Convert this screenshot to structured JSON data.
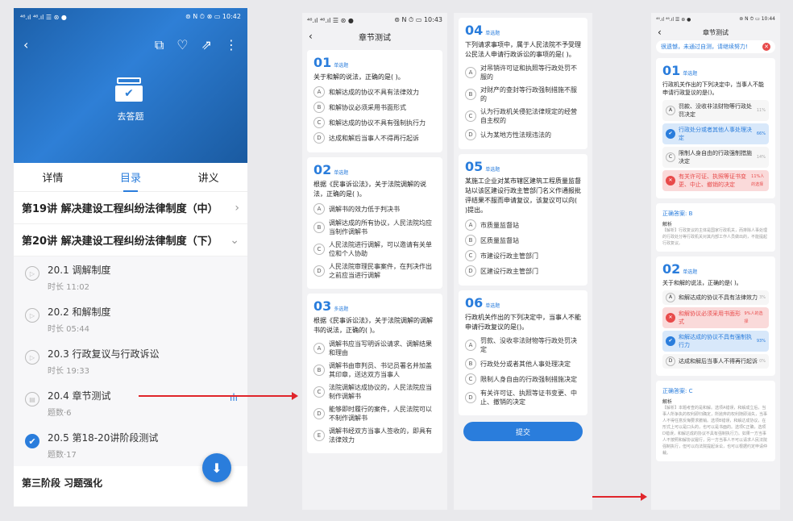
{
  "panel1": {
    "status_left": "⁴⁶.ıl ⁴⁶.ıl ☰ ⊛ ●",
    "status_right": "⊚ N ⏱ ⊗ ▭ 10:42",
    "hero_label": "去答题",
    "tabs": [
      "详情",
      "目录",
      "讲义"
    ],
    "sections": [
      {
        "title": "第19讲  解决建设工程纠纷法律制度（中）",
        "chevron": "›"
      },
      {
        "title": "第20讲  解决建设工程纠纷法律制度（下）",
        "chevron": "⌄"
      }
    ],
    "items": [
      {
        "title": "20.1  调解制度",
        "sub": "时长 11:02"
      },
      {
        "title": "20.2  和解制度",
        "sub": "时长 05:44"
      },
      {
        "title": "20.3  行政复议与行政诉讼",
        "sub": "时长 19:33"
      },
      {
        "title": "20.4  章节测试",
        "sub": "题数·6"
      },
      {
        "title": "20.5  第18-20讲阶段测试",
        "sub": "题数·17"
      }
    ],
    "stage_title": "第三阶段  习题强化"
  },
  "panel2": {
    "status_right": "⊚ N ⏱ ▭ 10:43",
    "title": "章节测试",
    "questions": [
      {
        "num": "01",
        "type": "单选题",
        "text": "关于和解的说法，正确的是(    )。",
        "options": [
          [
            "A",
            "和解达成的协议不具有法律效力"
          ],
          [
            "B",
            "和解协议必须采用书面形式"
          ],
          [
            "C",
            "和解达成的协议不具有强制执行力"
          ],
          [
            "D",
            "达成和解后当事人不得再行起诉"
          ]
        ]
      },
      {
        "num": "02",
        "type": "单选题",
        "text": "根据《民事诉讼法》，关于法院调解的说法，正确的是(    )。",
        "options": [
          [
            "A",
            "调解书的效力低于判决书"
          ],
          [
            "B",
            "调解达成的所有协议，人民法院均应当制作调解书"
          ],
          [
            "C",
            "人民法院进行调解，可以邀请有关单位和个人协助"
          ],
          [
            "D",
            "人民法院审理民事案件，在判决作出之前应当进行调解"
          ]
        ]
      },
      {
        "num": "03",
        "type": "多选题",
        "text": "根据《民事诉讼法》，关于法院调解的调解书的说法，正确的(    )。",
        "options": [
          [
            "A",
            "调解书应当写明诉讼请求、调解结果和理由"
          ],
          [
            "B",
            "调解书由审判员、书记员署名并加盖其印章，送达双方当事人"
          ],
          [
            "C",
            "法院调解达成协议的，人民法院应当制作调解书"
          ],
          [
            "D",
            "能够即时履行的案件，人民法院可以不制作调解书"
          ],
          [
            "E",
            "调解书经双方当事人签收的，即具有法律效力"
          ]
        ]
      }
    ]
  },
  "panel3": {
    "questions": [
      {
        "num": "04",
        "type": "单选题",
        "text": "下列请求事项中，属于人民法院不予受理公民法人申请行政诉讼的事项的是(    )。",
        "options": [
          [
            "A",
            "对吊销许可证和执照等行政处罚不服的"
          ],
          [
            "B",
            "对财产的查封等行政强制措施不服的"
          ],
          [
            "C",
            "认为行政机关侵犯法律规定的经营自主权的"
          ],
          [
            "D",
            "认为某地方性法规违法的"
          ]
        ]
      },
      {
        "num": "05",
        "type": "单选题",
        "text": "某施工企业对某市辖区建筑工程质量监督站以该区建设行政主管部门名义作通报批评结果不服而申请复议，该复议可以向(    )提出。",
        "options": [
          [
            "A",
            "市质量监督站"
          ],
          [
            "B",
            "区质量监督站"
          ],
          [
            "C",
            "市建设行政主管部门"
          ],
          [
            "D",
            "区建设行政主管部门"
          ]
        ]
      },
      {
        "num": "06",
        "type": "单选题",
        "text": "行政机关作出的下列决定中，当事人不能申请行政复议的是()。",
        "options": [
          [
            "A",
            "罚款、没收非法财物等行政处罚决定"
          ],
          [
            "B",
            "行政处分或者其他人事处理决定"
          ],
          [
            "C",
            "限制人身自由的行政强制措施决定"
          ],
          [
            "D",
            "有关许可证、执照等证书变更、中止、撤销的决定"
          ]
        ]
      }
    ],
    "submit_label": "提交"
  },
  "panel4": {
    "status_right": "⊚ N ⏱ ▭ 10:44",
    "title": "章节测试",
    "fail_msg": "很遗憾，未通过自测，请继续努力!",
    "q1": {
      "num": "01",
      "type": "单选题",
      "text": "行政机关作出的下列决定中，当事人不能申请行政复议的是()。",
      "options": [
        [
          "A",
          "罚款、没收非法财物等行政处罚决定",
          "11%"
        ],
        [
          "B",
          "行政处分或者其他人事处理决定",
          "66%"
        ],
        [
          "C",
          "限制人身自由的行政强制措施决定",
          "14%"
        ],
        [
          "D",
          "有关许可证、执照等证书变更、中止、撤销的决定",
          "11%人的选择"
        ]
      ],
      "answer": "正确答案: B",
      "exp_head": "解析",
      "exp": "【解析】行政复议的主体是国家行政机关，而排除人事处理的行政处分等行政机关对其内部工作人员做出的，不能提起行政复议。"
    },
    "q2": {
      "num": "02",
      "type": "单选题",
      "text": "关于和解的说法，正确的是(    )。",
      "options": [
        [
          "A",
          "和解达成的协议不具有法律效力",
          "3%"
        ],
        [
          "B",
          "和解协议必须采用书面形式",
          "9%人的选择"
        ],
        [
          "C",
          "和解达成的协议不具有强制执行力",
          "93%"
        ],
        [
          "D",
          "达成和解后当事人不得再行起诉",
          "0%"
        ]
      ],
      "answer": "正确答案: C",
      "exp_head": "解析",
      "exp": "【解析】本题考查的是和解。选项A错误，和解成立后，当事人所争执的权利即归确定，所抛弃的权利随即消失，当事人不得任意反悔要求撤销。选项B错误，和解达成协议，在形式上可以是口头的，也可以是书面的。选项C正确，选项D错误，和解达成的协议不具有强制执行力。如果一方当事人不按照和解协议履行，另一方当事人不可以请求人民法院强制执行，但可以向法院提起诉讼，也可以根据约定申请仲裁。"
    }
  }
}
